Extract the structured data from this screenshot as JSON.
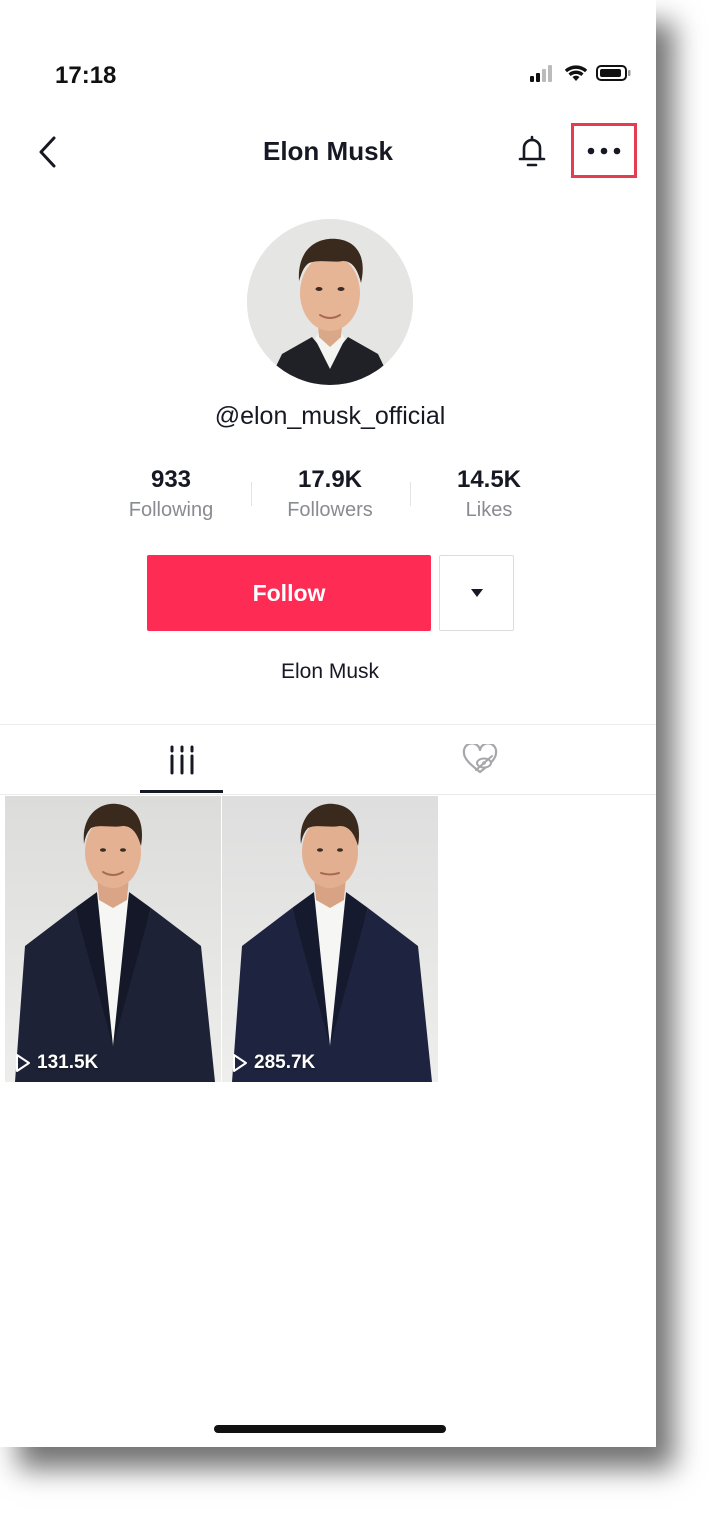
{
  "status_bar": {
    "time": "17:18",
    "icons": [
      "cellular-signal-icon",
      "wifi-icon",
      "battery-icon"
    ]
  },
  "nav": {
    "back_icon": "chevron-left-icon",
    "title": "Elon Musk",
    "bell_icon": "bell-icon",
    "more_icon": "more-dots-icon",
    "highlight_color": "#e33d4f"
  },
  "profile": {
    "username": "@elon_musk_official",
    "display_name": "Elon Musk",
    "stats": [
      {
        "value": "933",
        "label": "Following"
      },
      {
        "value": "17.9K",
        "label": "Followers"
      },
      {
        "value": "14.5K",
        "label": "Likes"
      }
    ]
  },
  "actions": {
    "follow_label": "Follow",
    "follow_color": "#fe2c55",
    "dropdown_icon": "caret-down-icon"
  },
  "tabs": [
    {
      "name": "videos",
      "icon": "grid-lines-icon",
      "active": true
    },
    {
      "name": "liked",
      "icon": "heart-hidden-icon",
      "active": false
    }
  ],
  "videos": [
    {
      "views": "131.5K"
    },
    {
      "views": "285.7K"
    }
  ]
}
